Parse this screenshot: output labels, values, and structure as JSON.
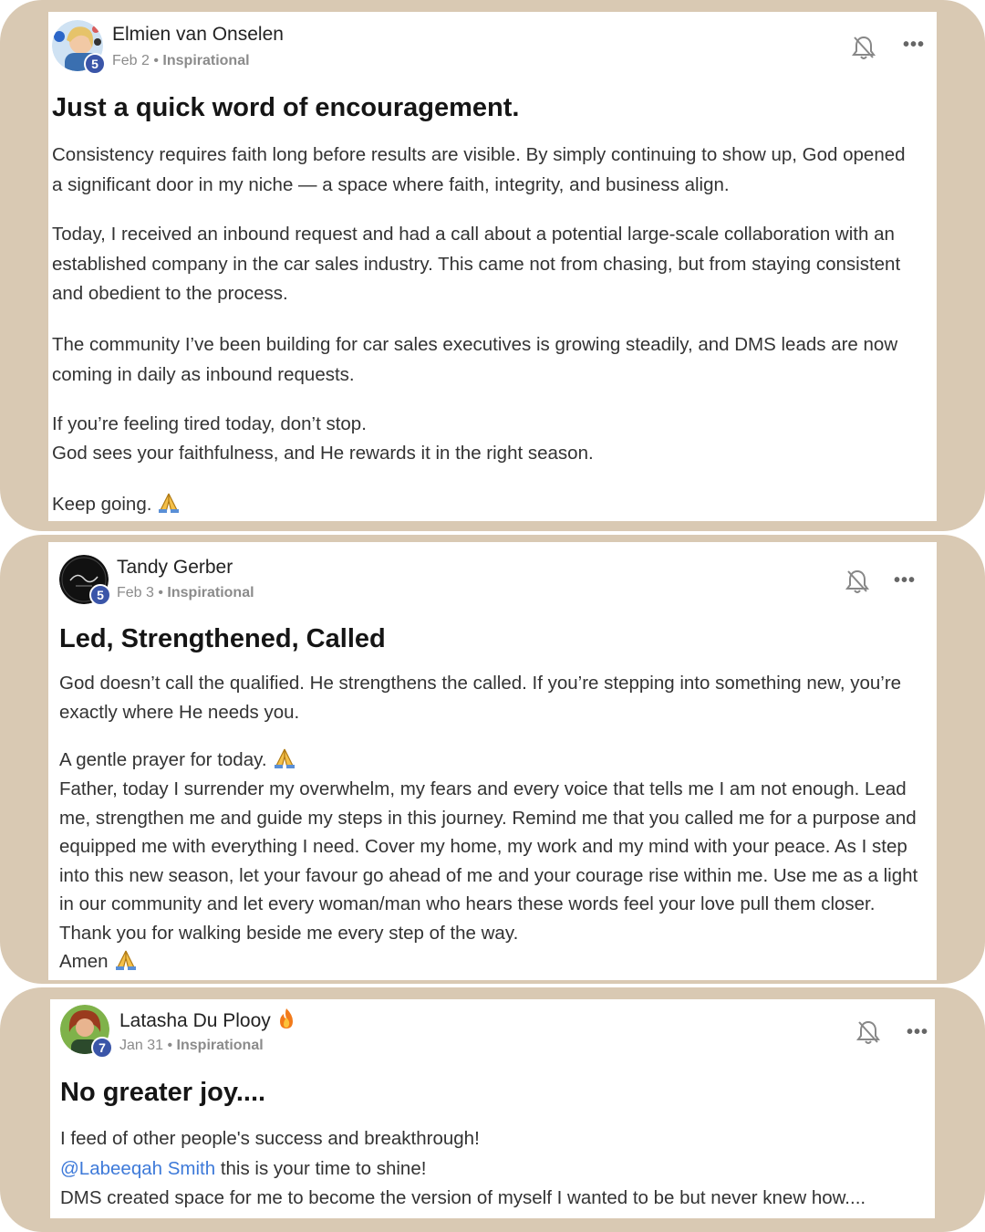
{
  "posts": [
    {
      "author": "Elmien van Onselen",
      "level": "5",
      "date": "Feb 2",
      "separator": " • ",
      "category": "Inspirational",
      "title": "Just a quick word of encouragement.",
      "paragraphs": [
        "Consistency requires faith long before results are visible. By simply continuing to show up, God opened a significant door in my niche — a space where faith, integrity, and business align.",
        "Today, I received an inbound request and had a call about a potential large-scale collaboration with an established company in the car sales industry. This came not from chasing, but from staying consistent and obedient to the process.",
        "The community I’ve been building for car sales executives is growing steadily, and DMS leads are now coming in daily as inbound requests.",
        "If you’re feeling tired today, don’t stop.",
        "God sees your faithfulness, and He rewards it in the right season.",
        "Keep going."
      ]
    },
    {
      "author": "Tandy Gerber",
      "level": "5",
      "date": "Feb 3",
      "separator": " • ",
      "category": "Inspirational",
      "title": "Led, Strengthened, Called",
      "paragraphs": [
        "God doesn’t call the qualified. He strengthens the called. If you’re stepping into something new, you’re exactly where He needs you.",
        "A gentle prayer for today.",
        "Father, today I surrender my overwhelm, my fears and every voice that tells me I am not enough. Lead me, strengthen me and guide my steps in this journey. Remind me that you called me for a purpose and equipped me with everything I need. Cover my home, my work and my mind with your peace. As I step into this new season, let your favour go ahead of me and your courage rise within me. Use me as a light in our community and let every woman/man who hears these words feel your love pull them closer. Thank you for walking beside me every step of the way.",
        "Amen"
      ]
    },
    {
      "author": "Latasha Du Plooy",
      "level": "7",
      "date": "Jan 31",
      "separator": " • ",
      "category": "Inspirational",
      "title": "No greater joy....",
      "paragraphs": [
        "I feed of other people's success and breakthrough!",
        "@Labeeqah Smith",
        " this is your time to shine!",
        "DMS created space for me to become the version of myself I wanted to be but never knew how...."
      ]
    }
  ],
  "icons": {
    "bell": "bell-off-icon",
    "more": "more-horizontal-icon",
    "pray": "folded-hands-emoji",
    "fire": "fire-emoji"
  },
  "colors": {
    "frame": "#d9c9b3",
    "badge": "#3a55a8",
    "mention": "#3e7ad9",
    "meta": "#8b8b8b"
  }
}
